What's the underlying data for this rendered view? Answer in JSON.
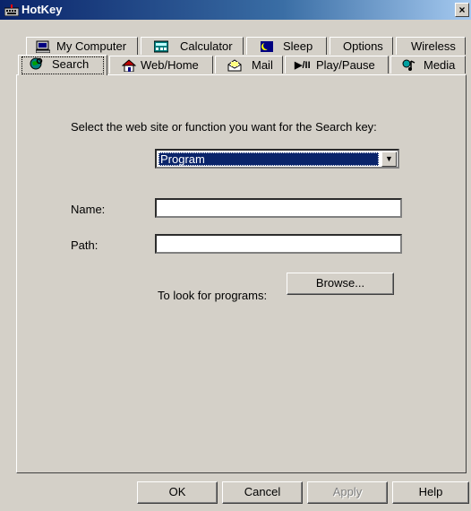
{
  "window": {
    "title": "HotKey",
    "close_glyph": "×"
  },
  "tabs_row1": [
    {
      "label": "My Computer",
      "icon": "computer-icon"
    },
    {
      "label": "Calculator",
      "icon": "calculator-icon"
    },
    {
      "label": "Sleep",
      "icon": "sleep-icon"
    },
    {
      "label": "Options",
      "icon": ""
    },
    {
      "label": "Wireless",
      "icon": ""
    }
  ],
  "tabs_row2": [
    {
      "label": "Search",
      "icon": "globe-search-icon",
      "active": true
    },
    {
      "label": "Web/Home",
      "icon": "web-home-icon"
    },
    {
      "label": "Mail",
      "icon": "mail-icon"
    },
    {
      "label": "Play/Pause",
      "icon": "play-pause-icon"
    },
    {
      "label": "Media",
      "icon": "media-icon"
    }
  ],
  "play_pause_glyph": "▶/II",
  "panel": {
    "instruction": "Select the web site or function you want for the Search key:",
    "function_select": {
      "value": "Program",
      "arrow": "▼"
    },
    "name_label": "Name:",
    "name_value": "",
    "path_label": "Path:",
    "path_value": "",
    "browse_hint": "To look for programs:",
    "browse_button": "Browse..."
  },
  "footer": {
    "ok": "OK",
    "cancel": "Cancel",
    "apply": "Apply",
    "help": "Help"
  }
}
